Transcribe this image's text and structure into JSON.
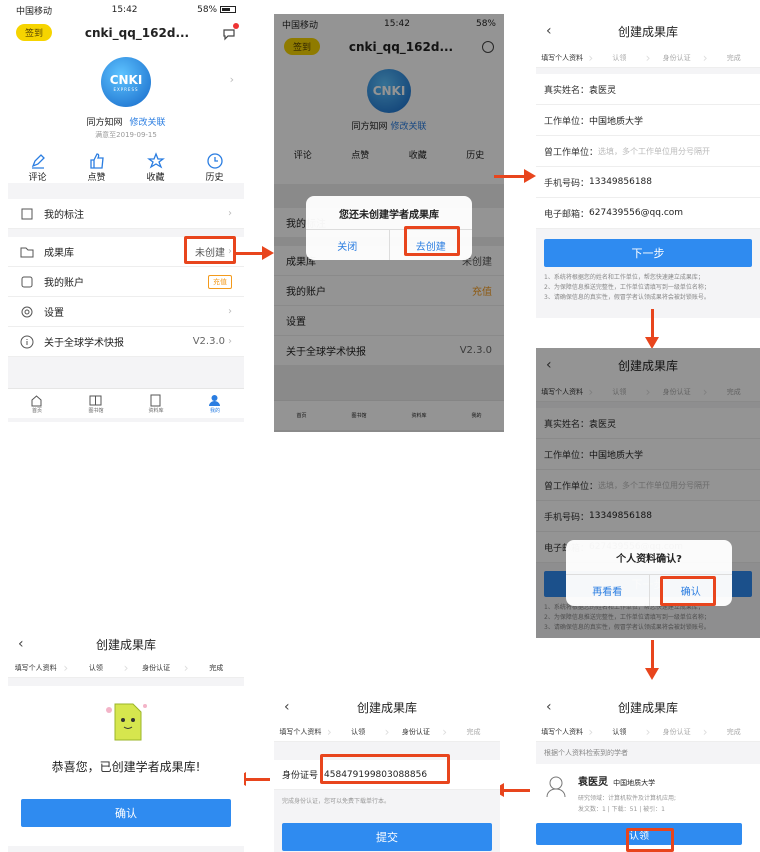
{
  "status": {
    "carrier": "中国移动",
    "time": "15:42",
    "battery": "58%"
  },
  "profile": {
    "signin": "签到",
    "username": "cnki_qq_162d...",
    "logo_main": "CNKI",
    "logo_sub": "EXPRESS",
    "org": "同方知网",
    "modify_link": "修改关联",
    "expire": "满意至2019-09-15",
    "actions": [
      "评论",
      "点赞",
      "收藏",
      "历史"
    ]
  },
  "menu": {
    "mark": "我的标注",
    "results": "成果库",
    "not_created": "未创建",
    "account": "我的账户",
    "recharge": "充值",
    "settings": "设置",
    "about": "关于全球学术快报",
    "version": "V2.3.0"
  },
  "tabs": [
    "首页",
    "图书馆",
    "资料库",
    "我的"
  ],
  "dialog1": {
    "title": "您还未创建学者成果库",
    "close": "关闭",
    "create": "去创建"
  },
  "create": {
    "title": "创建成果库",
    "steps": [
      "填写个人资料",
      "认领",
      "身份认证",
      "完成"
    ],
    "name_label": "真实姓名：",
    "name_value": "袁医灵",
    "unit_label": "工作单位：",
    "unit_value": "中国地质大学",
    "prev_unit_label": "曾工作单位：",
    "prev_unit_placeholder": "选填，多个工作单位用分号隔开",
    "phone_label": "手机号码：",
    "phone_value": "13349856188",
    "email_label": "电子邮箱：",
    "email_value": "627439556@qq.com",
    "next": "下一步",
    "notes": [
      "1、系统将根据您的姓名和工作单位，帮您快速建立成果库；",
      "2、为保障信息推送完整性，工作单位请填写到一级单位名称；",
      "3、请确保信息的真实性，假冒学者认领成果将会被封锁账号。"
    ]
  },
  "dialog2": {
    "title": "个人资料确认?",
    "review": "再看看",
    "confirm": "确认"
  },
  "claim": {
    "found_label": "根据个人资料检索到的学者",
    "scholar_name": "袁医灵",
    "scholar_unit": "中国地质大学",
    "field": "研究领域：计算机软件及计算机应用;",
    "stats": "发文数：1 | 下载：51 | 被引：1",
    "claim_btn": "认领"
  },
  "idverify": {
    "label": "身份证号",
    "value": "458479199803088856",
    "hint": "完成身份认证，您可以免费下载单行本。",
    "submit": "提交"
  },
  "done": {
    "message": "恭喜您，已创建学者成果库!",
    "confirm": "确认"
  }
}
